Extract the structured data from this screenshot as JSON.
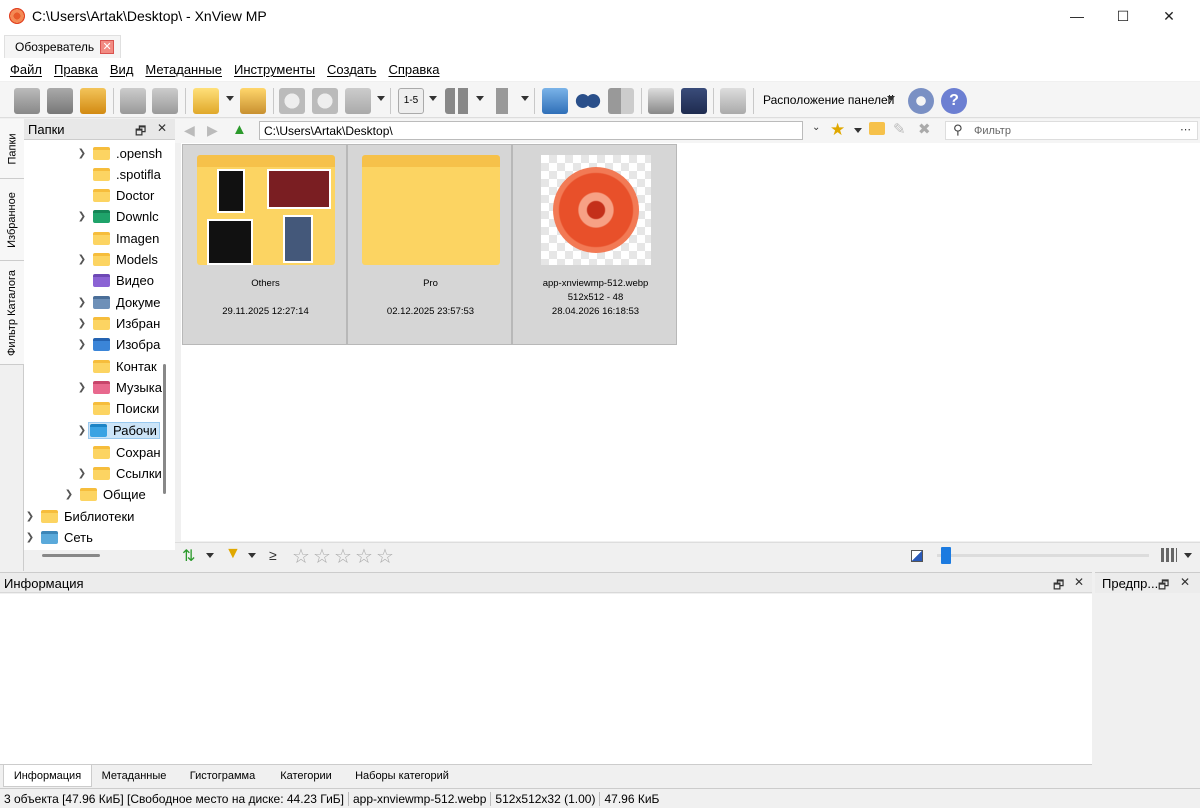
{
  "window": {
    "title": "C:\\Users\\Artak\\Desktop\\ - XnView MP",
    "minimize": "—",
    "maximize": "☐",
    "close": "✕"
  },
  "tab": {
    "label": "Обозреватель",
    "close": "✕"
  },
  "menu": [
    "Файл",
    "Правка",
    "Вид",
    "Метаданные",
    "Инструменты",
    "Создать",
    "Справка"
  ],
  "toolbar": {
    "layout_label": "Расположение панелей",
    "page_range_label": "1-5"
  },
  "side_tabs": [
    "Папки",
    "Избранное",
    "Фильтр Каталога"
  ],
  "folders_panel": {
    "title": "Папки"
  },
  "tree": [
    {
      "label": ".opensh",
      "icon": "folder-icon"
    },
    {
      "label": ".spotifla",
      "icon": "folder-icon"
    },
    {
      "label": "Doctor",
      "icon": "folder-icon"
    },
    {
      "label": "Downlc",
      "icon": "download-folder-icon"
    },
    {
      "label": "Imagen",
      "icon": "folder-icon"
    },
    {
      "label": "Models",
      "icon": "folder-icon"
    },
    {
      "label": "Видео",
      "icon": "video-folder-icon"
    },
    {
      "label": "Докуме",
      "icon": "documents-folder-icon"
    },
    {
      "label": "Избран",
      "icon": "folder-icon"
    },
    {
      "label": "Изобра",
      "icon": "pictures-folder-icon"
    },
    {
      "label": "Контак",
      "icon": "folder-icon"
    },
    {
      "label": "Музыка",
      "icon": "music-folder-icon"
    },
    {
      "label": "Поиски",
      "icon": "folder-icon"
    },
    {
      "label": "Рабочи",
      "icon": "desktop-folder-icon"
    },
    {
      "label": "Сохран",
      "icon": "folder-icon"
    },
    {
      "label": "Ссылки",
      "icon": "folder-icon"
    },
    {
      "label": "Общие",
      "icon": "folder-icon"
    },
    {
      "label": "Библиотеки",
      "icon": "libraries-icon"
    },
    {
      "label": "Сеть",
      "icon": "network-icon"
    }
  ],
  "address": {
    "path": "C:\\Users\\Artak\\Desktop\\",
    "filter_placeholder": "Фильтр"
  },
  "items": [
    {
      "name": "Others",
      "line2": "",
      "line3": "29.11.2025 12:27:14"
    },
    {
      "name": "Pro",
      "line2": "",
      "line3": "02.12.2025 23:57:53"
    },
    {
      "name": "app-xnviewmp-512.webp",
      "line2": "512x512 - 48",
      "line3": "28.04.2026 16:18:53"
    }
  ],
  "browser_bar": {
    "rating_op": "≥",
    "stars": 5
  },
  "info_panel": {
    "title": "Информация"
  },
  "preview_panel": {
    "title": "Предпр..."
  },
  "bottom_tabs": [
    "Информация",
    "Метаданные",
    "Гистограмма",
    "Категории",
    "Наборы категорий"
  ],
  "status": [
    "3 объекта [47.96 КиБ] [Свободное место на диске: 44.23 ГиБ]",
    "app-xnviewmp-512.webp",
    "512x512x32 (1.00)",
    "47.96 КиБ"
  ],
  "colors": {
    "accent": "#1c7be0",
    "selection": "#cce4f7",
    "thumb_bg": "#d6d6d6"
  }
}
